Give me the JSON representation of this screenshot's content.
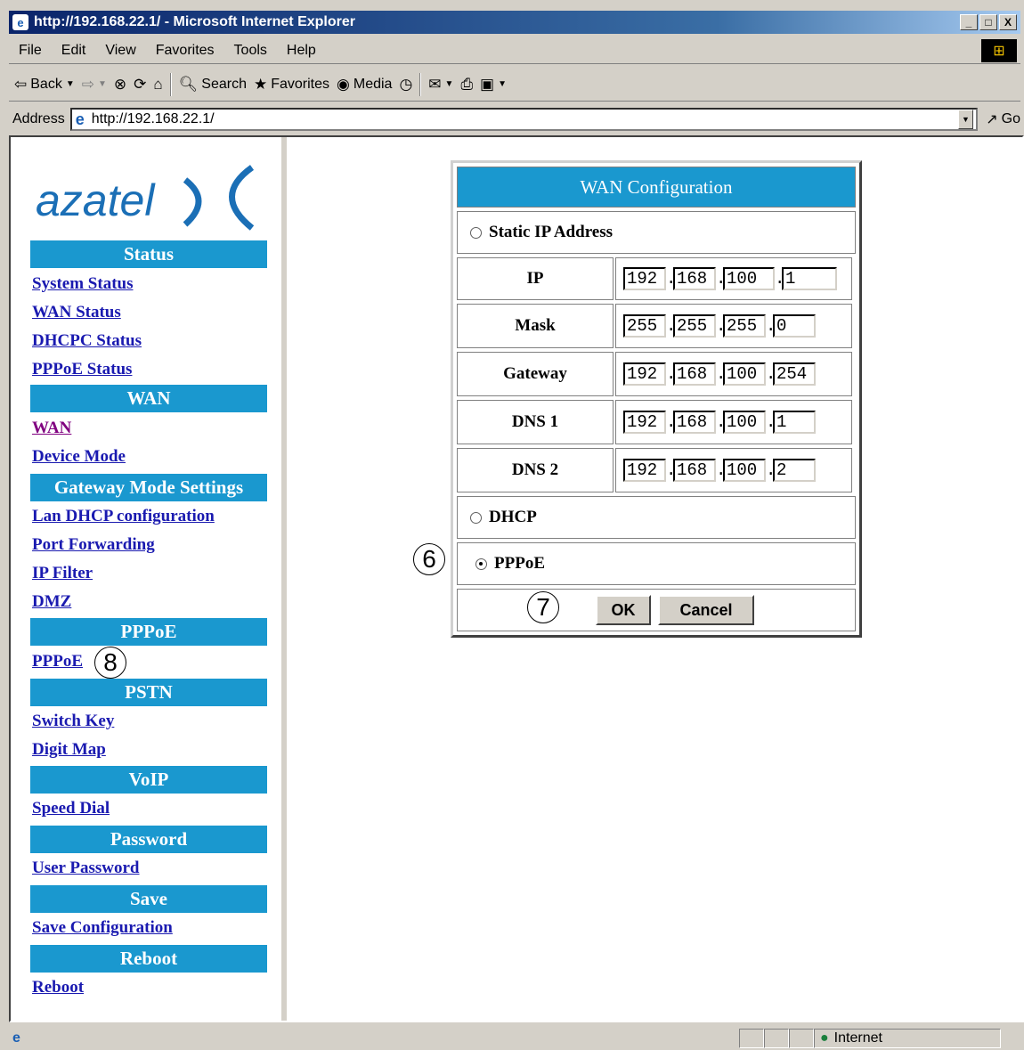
{
  "window": {
    "title": "http://192.168.22.1/ - Microsoft Internet Explorer",
    "controls": [
      "_",
      "□",
      "X"
    ]
  },
  "menubar": {
    "items": [
      "File",
      "Edit",
      "View",
      "Favorites",
      "Tools",
      "Help"
    ]
  },
  "toolbar": {
    "back": "Back",
    "search": "Search",
    "favorites": "Favorites",
    "media": "Media"
  },
  "address": {
    "label": "Address",
    "url": "http://192.168.22.1/",
    "go": "Go"
  },
  "sidebar": {
    "logo": "azatel",
    "sections": [
      {
        "head": "Status",
        "links": [
          "System Status",
          "WAN Status",
          "DHCPC Status",
          "PPPoE Status"
        ]
      },
      {
        "head": "WAN",
        "links": [
          "WAN",
          "Device Mode"
        ]
      },
      {
        "head": "Gateway Mode Settings",
        "links": [
          "Lan DHCP configuration",
          "Port Forwarding",
          "IP Filter",
          "DMZ"
        ]
      },
      {
        "head": "PPPoE",
        "links": [
          "PPPoE"
        ]
      },
      {
        "head": "PSTN",
        "links": [
          "Switch Key",
          "Digit Map"
        ]
      },
      {
        "head": "VoIP",
        "links": [
          "Speed Dial"
        ]
      },
      {
        "head": "Password",
        "links": [
          "User Password"
        ]
      },
      {
        "head": "Save",
        "links": [
          "Save Configuration"
        ]
      },
      {
        "head": "Reboot",
        "links": [
          "Reboot"
        ]
      }
    ]
  },
  "wan": {
    "title": "WAN Configuration",
    "static_label": "Static IP Address",
    "fields": [
      {
        "label": "IP",
        "octets": [
          "192",
          "168",
          "100",
          "1"
        ]
      },
      {
        "label": "Mask",
        "octets": [
          "255",
          "255",
          "255",
          "0"
        ]
      },
      {
        "label": "Gateway",
        "octets": [
          "192",
          "168",
          "100",
          "254"
        ]
      },
      {
        "label": "DNS 1",
        "octets": [
          "192",
          "168",
          "100",
          "1"
        ]
      },
      {
        "label": "DNS 2",
        "octets": [
          "192",
          "168",
          "100",
          "2"
        ]
      }
    ],
    "dhcp_label": "DHCP",
    "pppoe_label": "PPPoE",
    "selected": "PPPoE",
    "ok": "OK",
    "cancel": "Cancel"
  },
  "callouts": {
    "pppoe_radio": "6",
    "ok_button": "7",
    "pppoe_link": "8"
  },
  "statusbar": {
    "zone": "Internet"
  },
  "colors": {
    "nav_head": "#1a98cf",
    "link": "#1a1ab0",
    "visited": "#800080",
    "logo": "#1b6fb6"
  }
}
